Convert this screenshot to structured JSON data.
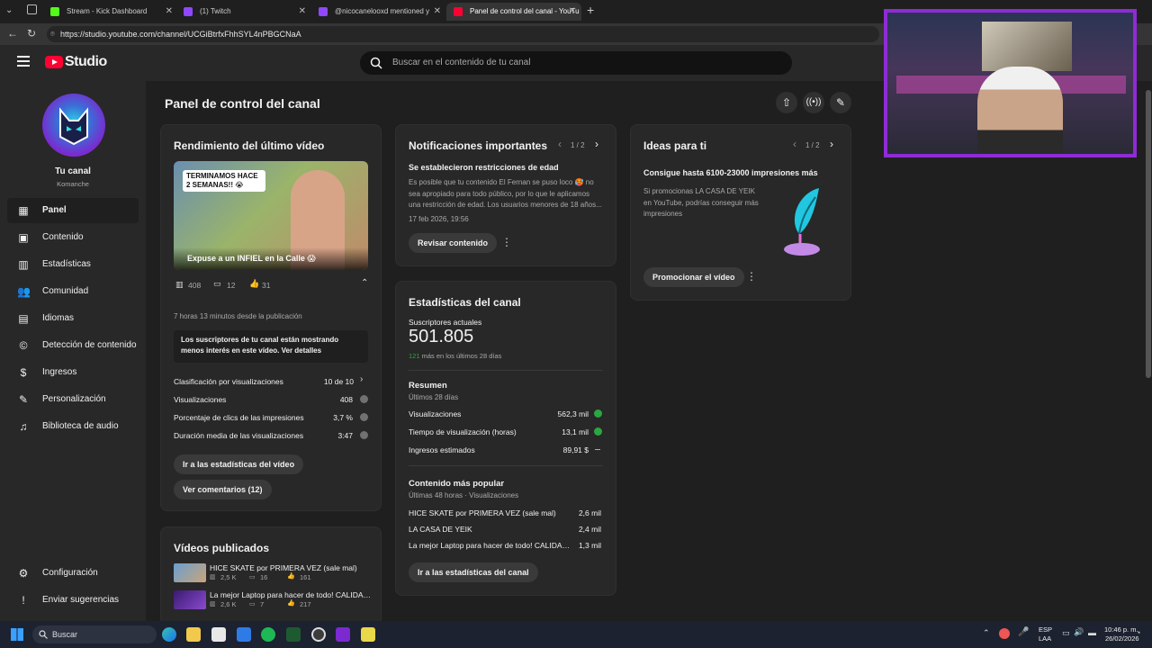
{
  "browser": {
    "tabs": [
      {
        "label": "Stream - Kick Dashboard",
        "color": "#53fc18"
      },
      {
        "label": "(1) Twitch",
        "color": "#9146ff"
      },
      {
        "label": "@nicocanelooxd mentioned y",
        "color": "#9146ff"
      },
      {
        "label": "Panel de control del canal - YouTu",
        "color": "#ff0033"
      }
    ],
    "url": "https://studio.youtube.com/channel/UCGiBtrfxFhhSYL4nPBGCNaA"
  },
  "header": {
    "logo_text": "Studio",
    "search_placeholder": "Buscar en el contenido de tu canal"
  },
  "sidebar": {
    "channel_title": "Tu canal",
    "channel_name": "Komanche",
    "items": [
      {
        "label": "Panel",
        "icon": "dashboard-icon"
      },
      {
        "label": "Contenido",
        "icon": "content-icon"
      },
      {
        "label": "Estadísticas",
        "icon": "analytics-icon"
      },
      {
        "label": "Comunidad",
        "icon": "community-icon"
      },
      {
        "label": "Idiomas",
        "icon": "subtitles-icon"
      },
      {
        "label": "Detección de contenido",
        "icon": "copyright-icon"
      },
      {
        "label": "Ingresos",
        "icon": "earn-icon"
      },
      {
        "label": "Personalización",
        "icon": "customization-icon"
      },
      {
        "label": "Biblioteca de audio",
        "icon": "audio-library-icon"
      }
    ],
    "bottom": [
      {
        "label": "Configuración",
        "icon": "settings-icon"
      },
      {
        "label": "Enviar sugerencias",
        "icon": "feedback-icon"
      }
    ]
  },
  "main": {
    "page_title": "Panel de control del canal",
    "latest": {
      "title": "Rendimiento del último vídeo",
      "thumb_overlay": "TERMINAMOS HACE 2 SEMANAS!! 😭",
      "video_title": "Expuse a un INFIEL en la Calle 😱",
      "views": "408",
      "comments": "12",
      "likes": "31",
      "since": "7 horas 13 minutos desde la publicación",
      "notice": "Los suscriptores de tu canal están mostrando menos interés en este vídeo.",
      "notice_link": "Ver detalles",
      "rows": [
        {
          "label": "Clasificación por visualizaciones",
          "value": "10 de 10"
        },
        {
          "label": "Visualizaciones",
          "value": "408"
        },
        {
          "label": "Porcentaje de clics de las impresiones",
          "value": "3,7 %"
        },
        {
          "label": "Duración media de las visualizaciones",
          "value": "3:47"
        }
      ],
      "btn_stats": "Ir a las estadísticas del vídeo",
      "btn_comments": "Ver comentarios (12)"
    },
    "published": {
      "title": "Vídeos publicados",
      "videos": [
        {
          "title": "HICE SKATE por PRIMERA VEZ (sale mal)",
          "views": "2,5 K",
          "comments": "16",
          "likes": "161"
        },
        {
          "title": "La mejor Laptop para hacer de todo! CALIDAD ...",
          "views": "2,6 K",
          "comments": "7",
          "likes": "217"
        }
      ]
    },
    "notifications": {
      "title": "Notificaciones importantes",
      "pager": "1 / 2",
      "heading": "Se establecieron restricciones de edad",
      "body": "Es posible que tu contenido El Fernan se puso loco 🥵 no sea apropiado para todo público, por lo que le aplicamos una restricción de edad. Los usuarios menores de 18 años...",
      "date": "17 feb 2026, 19:56",
      "button": "Revisar contenido"
    },
    "ideas": {
      "title": "Ideas para ti",
      "pager": "1 / 2",
      "heading": "Consigue hasta 6100-23000 impresiones más",
      "body": "Si promocionas LA CASA DE YEIK en YouTube, podrías conseguir más impresiones",
      "button": "Promocionar el vídeo"
    },
    "channel_stats": {
      "title": "Estadísticas del canal",
      "subs_label": "Suscriptores actuales",
      "subs_value": "501.805",
      "subs_delta": "121",
      "subs_delta_text": "más en los últimos 28 días",
      "summary_title": "Resumen",
      "summary_sub": "Últimos 28 días",
      "summary": [
        {
          "label": "Visualizaciones",
          "value": "562,3 mil",
          "trend": "up"
        },
        {
          "label": "Tiempo de visualización (horas)",
          "value": "13,1 mil",
          "trend": "up"
        },
        {
          "label": "Ingresos estimados",
          "value": "89,91 $",
          "trend": "flat"
        }
      ],
      "popular_title": "Contenido más popular",
      "popular_sub": "Últimas 48 horas · Visualizaciones",
      "popular": [
        {
          "label": "HICE SKATE por PRIMERA VEZ (sale mal)",
          "value": "2,6 mil"
        },
        {
          "label": "LA CASA DE YEIK",
          "value": "2,4 mil"
        },
        {
          "label": "La mejor Laptop para hacer de todo! CALIDAD PR...",
          "value": "1,3 mil"
        }
      ],
      "button": "Ir a las estadísticas del canal"
    }
  },
  "taskbar": {
    "search": "Buscar",
    "lang": "ESP",
    "lang2": "LAA",
    "time": "10:46 p. m.",
    "date": "26/02/2026"
  },
  "colors": {
    "accent_red": "#ff0033",
    "green": "#2ba640",
    "webcam_border": "#8f2bd6"
  }
}
